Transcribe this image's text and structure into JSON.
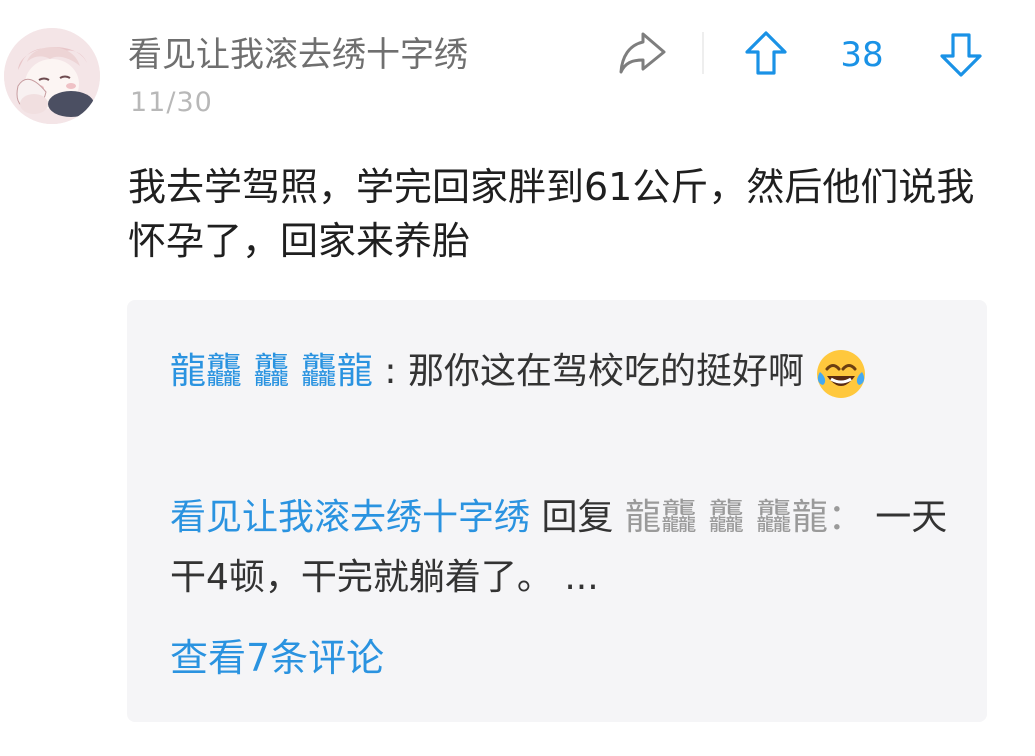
{
  "post": {
    "author": "看见让我滚去绣十字绣",
    "date": "11/30",
    "vote_count": "38",
    "content": "我去学驾照，学完回家胖到61公斤，然后他们说我怀孕了，回家来养胎"
  },
  "replies": [
    {
      "user": "龍龘 龘 龘龍",
      "separator": ":",
      "text": "那你这在驾校吃的挺好啊",
      "emoji": "laughing-crying-emoji"
    },
    {
      "user": "看见让我滚去绣十字绣",
      "reply_word": "回复",
      "target_user": "龍龘 龘 龘龍",
      "separator": "：",
      "text": "一天干4顿，干完就躺着了。 ..."
    }
  ],
  "reply_footer": {
    "view_more_label": "查看7条评论"
  },
  "icons": {
    "share": "share-icon",
    "upvote": "upvote-arrow-icon",
    "downvote": "downvote-arrow-icon"
  },
  "colors": {
    "accent": "#1a92e6",
    "reply_bg": "#f5f5f7",
    "muted_text": "#9a9a9a"
  }
}
